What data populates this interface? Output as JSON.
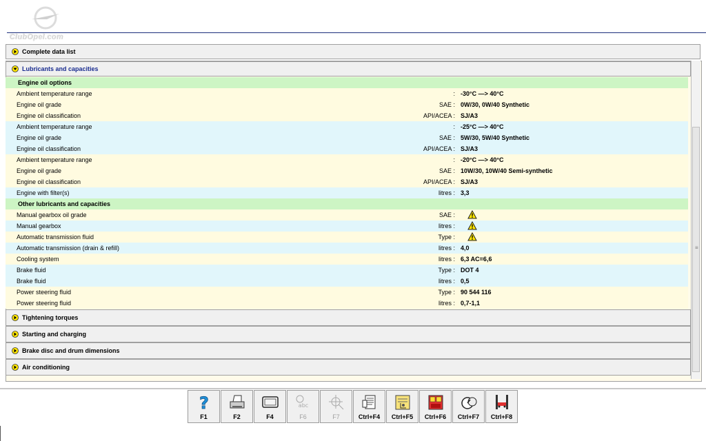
{
  "brand": {
    "logo_text": "ClubOpel.com"
  },
  "sections": {
    "complete": "Complete data list",
    "lubricants": "Lubricants and capacities",
    "tightening": "Tightening torques",
    "starting": "Starting and charging",
    "brake_disc": "Brake disc and drum dimensions",
    "air": "Air conditioning"
  },
  "groups": {
    "engine_oil": "Engine oil options",
    "other": "Other lubricants and capacities"
  },
  "rows": [
    {
      "label": "Ambient temperature range",
      "unit": ":",
      "value": "-30°C —> 40°C"
    },
    {
      "label": "Engine oil grade",
      "unit": "SAE :",
      "value": "0W/30, 0W/40 Synthetic"
    },
    {
      "label": "Engine oil classification",
      "unit": "API/ACEA :",
      "value": "SJ/A3"
    },
    {
      "label": "Ambient temperature range",
      "unit": ":",
      "value": "-25°C —> 40°C"
    },
    {
      "label": "Engine oil grade",
      "unit": "SAE :",
      "value": "5W/30, 5W/40 Synthetic"
    },
    {
      "label": "Engine oil classification",
      "unit": "API/ACEA :",
      "value": "SJ/A3"
    },
    {
      "label": "Ambient temperature range",
      "unit": ":",
      "value": "-20°C —> 40°C"
    },
    {
      "label": "Engine oil grade",
      "unit": "SAE :",
      "value": "10W/30, 10W/40 Semi-synthetic"
    },
    {
      "label": "Engine oil classification",
      "unit": "API/ACEA :",
      "value": "SJ/A3"
    },
    {
      "label": "Engine with filter(s)",
      "unit": "litres :",
      "value": "3,3"
    },
    {
      "label": "Manual gearbox oil grade",
      "unit": "SAE :",
      "value": ""
    },
    {
      "label": "Manual gearbox",
      "unit": "litres :",
      "value": ""
    },
    {
      "label": "Automatic transmission fluid",
      "unit": "Type :",
      "value": ""
    },
    {
      "label": "Automatic transmission (drain & refill)",
      "unit": "litres :",
      "value": "4,0"
    },
    {
      "label": "Cooling system",
      "unit": "litres :",
      "value": "6,3 AC=6,6"
    },
    {
      "label": "Brake fluid",
      "unit": "Type :",
      "value": "DOT 4"
    },
    {
      "label": "Brake fluid",
      "unit": "litres :",
      "value": "0,5"
    },
    {
      "label": "Power steering fluid",
      "unit": "Type :",
      "value": "90 544 116"
    },
    {
      "label": "Power steering fluid",
      "unit": "litres :",
      "value": "0,7-1,1"
    }
  ],
  "toolbar": {
    "f1": "F1",
    "f2": "F2",
    "f4": "F4",
    "f6": "F6",
    "f7": "F7",
    "cf4": "Ctrl+F4",
    "cf5": "Ctrl+F5",
    "cf6": "Ctrl+F6",
    "cf7": "Ctrl+F7",
    "cf8": "Ctrl+F8"
  },
  "colors": {
    "accent": "#1a2d90",
    "group_bg": "#cdf5c4",
    "row_yellow": "#fffbe0",
    "row_blue": "#e1f6fb"
  }
}
